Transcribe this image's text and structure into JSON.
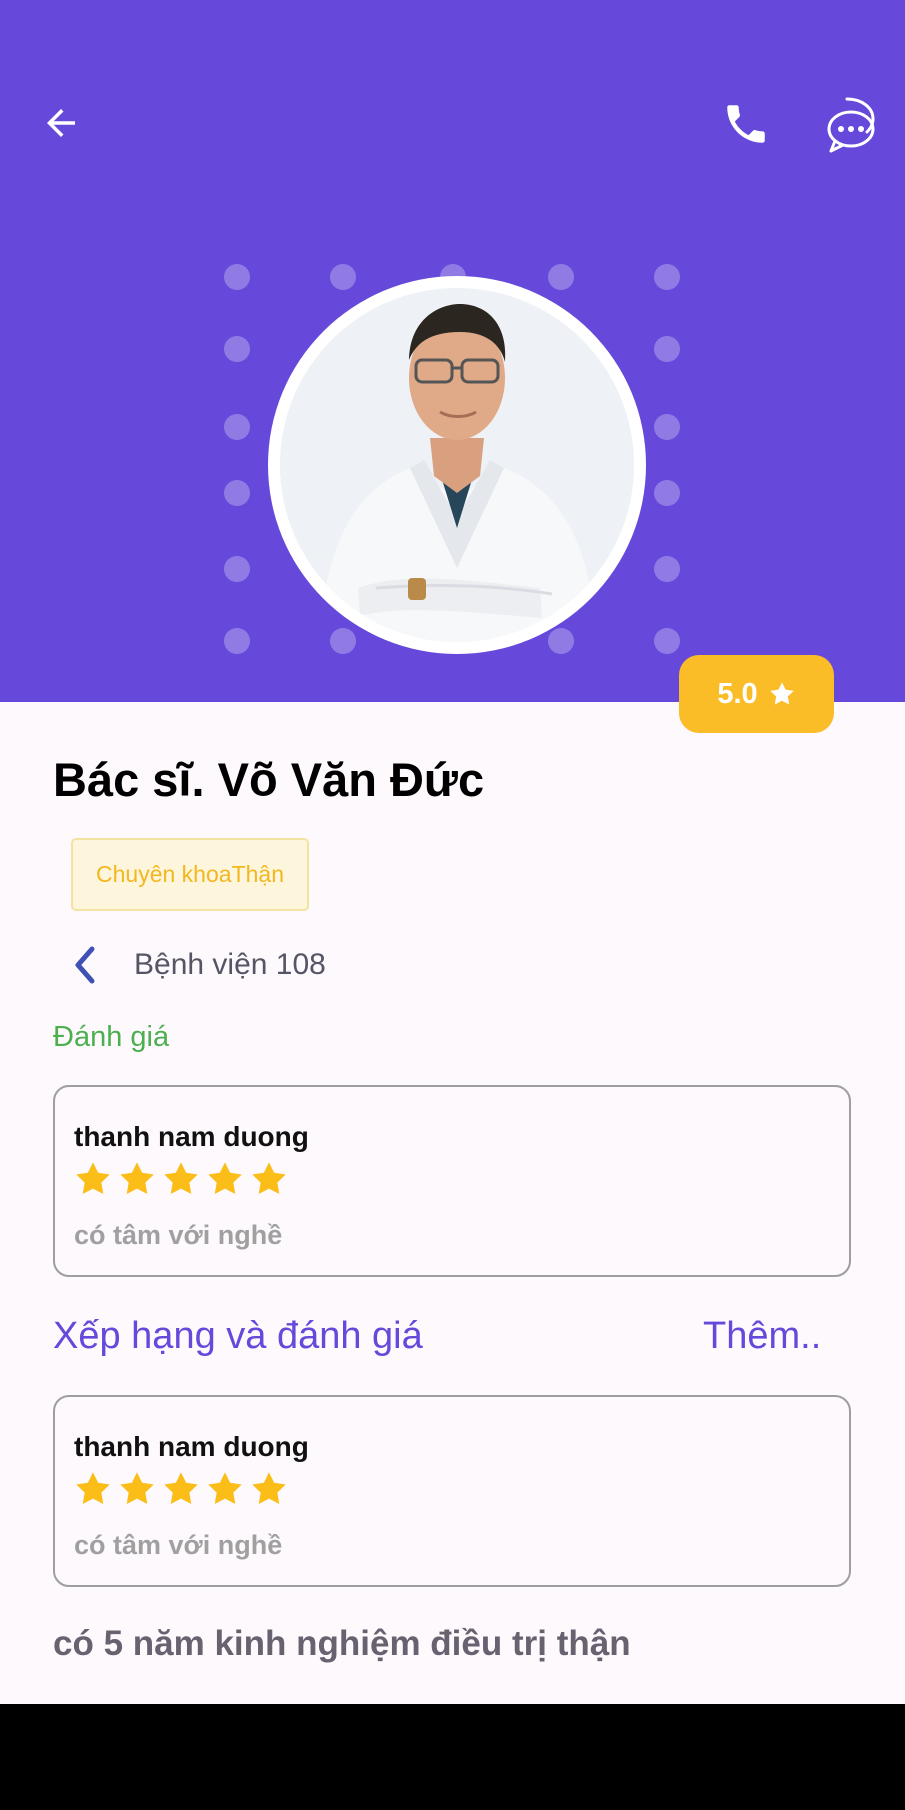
{
  "header": {
    "back_icon": "arrow-left-icon",
    "call_icon": "phone-icon",
    "chat_icon": "chat-bubbles-icon",
    "color": "#6648db"
  },
  "doctor": {
    "avatar_alt": "Doctor portrait",
    "rating": "5.0",
    "rating_icon": "star-icon",
    "name": "Bác sĩ. Võ Văn Đức",
    "specialty": "Chuyên khoaThận",
    "hospital": "Bệnh viện 108",
    "hospital_icon": "chevron-left-icon",
    "experience": "có 5 năm kinh nghiệm điều trị thận"
  },
  "review_section": {
    "label": "Đánh giá",
    "review": {
      "author": "thanh nam duong",
      "stars": 5,
      "text": "có tâm với nghề"
    }
  },
  "ratings_section": {
    "title": "Xếp hạng và đánh giá",
    "more_label": "Thêm..",
    "review": {
      "author": "thanh nam duong",
      "stars": 5,
      "text": "có tâm với nghề"
    }
  },
  "colors": {
    "accent": "#6648db",
    "rating_badge": "#fbbd27",
    "star": "#fbbd17",
    "section_label": "#4caf50"
  }
}
